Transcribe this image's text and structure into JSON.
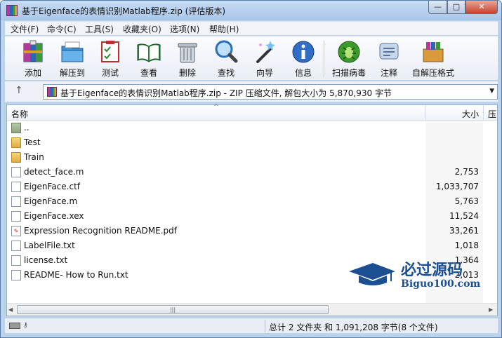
{
  "window": {
    "title": "基于Eigenface的表情识别Matlab程序.zip (评估版本)",
    "controls": {
      "minimize": "—",
      "maximize": "□",
      "close": "✕"
    }
  },
  "menu": [
    "文件(F)",
    "命令(C)",
    "工具(S)",
    "收藏夹(O)",
    "选项(N)",
    "帮助(H)"
  ],
  "toolbar": [
    {
      "label": "添加",
      "icon": "add-archive-icon"
    },
    {
      "label": "解压到",
      "icon": "extract-to-icon"
    },
    {
      "label": "测试",
      "icon": "test-icon"
    },
    {
      "label": "查看",
      "icon": "view-book-icon"
    },
    {
      "label": "删除",
      "icon": "trash-icon"
    },
    {
      "label": "查找",
      "icon": "magnifier-icon"
    },
    {
      "label": "向导",
      "icon": "wizard-wand-icon"
    },
    {
      "label": "信息",
      "icon": "info-icon"
    },
    {
      "label": "扫描病毒",
      "icon": "virus-scan-icon"
    },
    {
      "label": "注释",
      "icon": "comment-icon"
    },
    {
      "label": "自解压格式",
      "icon": "sfx-box-icon"
    }
  ],
  "address": {
    "up": "↑",
    "path": "基于Eigenface的表情识别Matlab程序.zip - ZIP 压缩文件, 解包大小为 5,870,930 字节",
    "dropdown": "▼"
  },
  "columns": {
    "name": "名称",
    "size": "大小",
    "packed": "压",
    "sort_indicator": "^"
  },
  "files": [
    {
      "name": "..",
      "size": "",
      "type": "up"
    },
    {
      "name": "Test",
      "size": "",
      "type": "folder"
    },
    {
      "name": "Train",
      "size": "",
      "type": "folder"
    },
    {
      "name": "detect_face.m",
      "size": "2,753",
      "type": "doc"
    },
    {
      "name": "EigenFace.ctf",
      "size": "1,033,707",
      "type": "doc"
    },
    {
      "name": "EigenFace.m",
      "size": "5,763",
      "type": "doc"
    },
    {
      "name": "EigenFace.xex",
      "size": "11,524",
      "type": "doc"
    },
    {
      "name": "Expression Recognition README.pdf",
      "size": "33,261",
      "type": "pdf"
    },
    {
      "name": "LabelFile.txt",
      "size": "1,018",
      "type": "doc"
    },
    {
      "name": "license.txt",
      "size": "1,364",
      "type": "doc"
    },
    {
      "name": "README- How to Run.txt",
      "size": "2,013",
      "type": "doc"
    }
  ],
  "scrollbar": {
    "left": "◀",
    "grip": "|||",
    "right": "▶"
  },
  "status": {
    "summary": "总计 2 文件夹 和 1,091,208 字节(8 个文件)"
  },
  "watermark": {
    "main": "必过源码",
    "sub": "Biguo100.com",
    "color": "#1b4f92"
  }
}
